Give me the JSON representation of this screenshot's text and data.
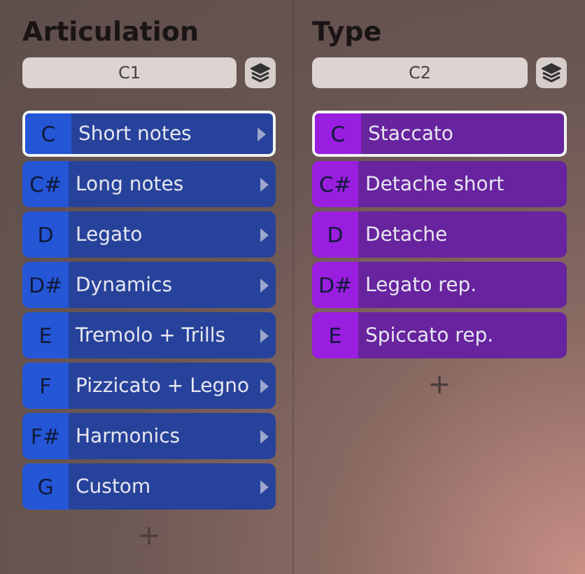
{
  "columns": [
    {
      "title": "Articulation",
      "field": "C1",
      "color": "#2456d6",
      "submenu": true,
      "add": "+",
      "items": [
        {
          "key": "C",
          "label": "Short notes",
          "selected": true
        },
        {
          "key": "C#",
          "label": "Long notes",
          "selected": false
        },
        {
          "key": "D",
          "label": "Legato",
          "selected": false
        },
        {
          "key": "D#",
          "label": "Dynamics",
          "selected": false
        },
        {
          "key": "E",
          "label": "Tremolo + Trills",
          "selected": false
        },
        {
          "key": "F",
          "label": "Pizzicato + Legno",
          "selected": false
        },
        {
          "key": "F#",
          "label": "Harmonics",
          "selected": false
        },
        {
          "key": "G",
          "label": "Custom",
          "selected": false
        }
      ]
    },
    {
      "title": "Type",
      "field": "C2",
      "color": "#9a1ee0",
      "submenu": false,
      "add": "+",
      "items": [
        {
          "key": "C",
          "label": "Staccato",
          "selected": true
        },
        {
          "key": "C#",
          "label": "Detache short",
          "selected": false
        },
        {
          "key": "D",
          "label": "Detache",
          "selected": false
        },
        {
          "key": "D#",
          "label": "Legato rep.",
          "selected": false
        },
        {
          "key": "E",
          "label": "Spiccato rep.",
          "selected": false
        }
      ]
    }
  ]
}
